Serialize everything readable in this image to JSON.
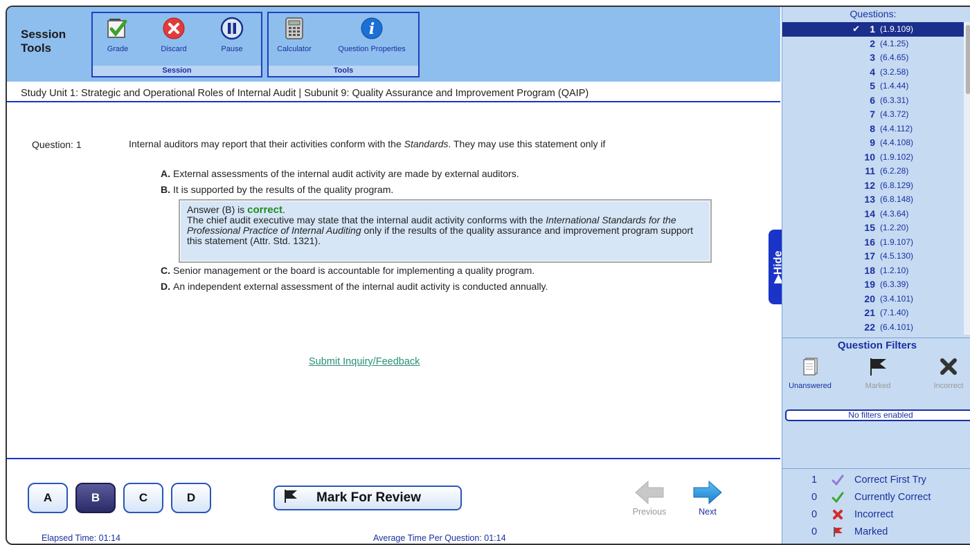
{
  "header": {
    "title": "Session Tools",
    "session_group": {
      "label": "Session",
      "tools": [
        {
          "label": "Grade",
          "icon": "grade-checkbox-icon"
        },
        {
          "label": "Discard",
          "icon": "discard-x-icon"
        },
        {
          "label": "Pause",
          "icon": "pause-icon"
        }
      ]
    },
    "tools_group": {
      "label": "Tools",
      "tools": [
        {
          "label": "Calculator",
          "icon": "calculator-icon"
        },
        {
          "label": "Question Properties",
          "icon": "info-icon"
        }
      ]
    }
  },
  "breadcrumb": "Study Unit 1: Strategic and Operational Roles of Internal Audit | Subunit 9: Quality Assurance and Improvement Program (QAIP)",
  "question": {
    "label": "Question: 1",
    "text_before": "Internal auditors may report that their activities conform with the ",
    "text_italic": "Standards",
    "text_after": ". They may use this statement only if",
    "choices": [
      {
        "letter": "A.",
        "text": "External assessments of the internal audit activity are made by external auditors."
      },
      {
        "letter": "B.",
        "text": "It is supported by the results of the quality program."
      },
      {
        "letter": "C.",
        "text": "Senior management or the board is accountable for implementing a quality program."
      },
      {
        "letter": "D.",
        "text": "An independent external assessment of the internal audit activity is conducted annually."
      }
    ],
    "answer": {
      "prefix": "Answer (B) is ",
      "status": "correct",
      "suffix": ".",
      "exp_1": "The chief audit executive may state that the internal audit activity conforms with the ",
      "exp_italic": "International Standards for the Professional Practice of Internal Auditing",
      "exp_2": " only if the results of the quality assurance and improvement program support this statement (Attr. Std. 1321)."
    }
  },
  "feedback_link": "Submit Inquiry/Feedback",
  "answer_buttons": [
    "A",
    "B",
    "C",
    "D"
  ],
  "selected_answer": "B",
  "mark_for_review": "Mark For Review",
  "nav": {
    "previous": "Previous",
    "next": "Next"
  },
  "footer": {
    "elapsed": "Elapsed Time: 01:14",
    "average": "Average Time Per Question: 01:14"
  },
  "questions_panel": {
    "header": "Questions:",
    "hide_label": "▶Hide",
    "items": [
      {
        "num": "1",
        "code": "(1.9.109)"
      },
      {
        "num": "2",
        "code": "(4.1.25)"
      },
      {
        "num": "3",
        "code": "(6.4.65)"
      },
      {
        "num": "4",
        "code": "(3.2.58)"
      },
      {
        "num": "5",
        "code": "(1.4.44)"
      },
      {
        "num": "6",
        "code": "(6.3.31)"
      },
      {
        "num": "7",
        "code": "(4.3.72)"
      },
      {
        "num": "8",
        "code": "(4.4.112)"
      },
      {
        "num": "9",
        "code": "(4.4.108)"
      },
      {
        "num": "10",
        "code": "(1.9.102)"
      },
      {
        "num": "11",
        "code": "(6.2.28)"
      },
      {
        "num": "12",
        "code": "(6.8.129)"
      },
      {
        "num": "13",
        "code": "(6.8.148)"
      },
      {
        "num": "14",
        "code": "(4.3.64)"
      },
      {
        "num": "15",
        "code": "(1.2.20)"
      },
      {
        "num": "16",
        "code": "(1.9.107)"
      },
      {
        "num": "17",
        "code": "(4.5.130)"
      },
      {
        "num": "18",
        "code": "(1.2.10)"
      },
      {
        "num": "19",
        "code": "(6.3.39)"
      },
      {
        "num": "20",
        "code": "(3.4.101)"
      },
      {
        "num": "21",
        "code": "(7.1.40)"
      },
      {
        "num": "22",
        "code": "(6.4.101)"
      }
    ],
    "selected_index": 0
  },
  "filters": {
    "title": "Question Filters",
    "items": [
      {
        "label": "Unanswered",
        "icon": "unanswered-pages-icon"
      },
      {
        "label": "Marked",
        "icon": "flag-icon"
      },
      {
        "label": "Incorrect",
        "icon": "x-icon"
      }
    ],
    "status": "No filters enabled"
  },
  "legend": [
    {
      "count": "1",
      "label": "Correct First Try",
      "icon": "purple-check-icon"
    },
    {
      "count": "0",
      "label": "Currently Correct",
      "icon": "green-check-icon"
    },
    {
      "count": "0",
      "label": "Incorrect",
      "icon": "red-x-icon"
    },
    {
      "count": "0",
      "label": "Marked",
      "icon": "red-flag-icon"
    }
  ],
  "colors": {
    "header_bg": "#8ebeed",
    "accent_blue": "#1a34c7",
    "correct_green": "#1e8c1e",
    "panel_bg": "#c6dbf2"
  }
}
